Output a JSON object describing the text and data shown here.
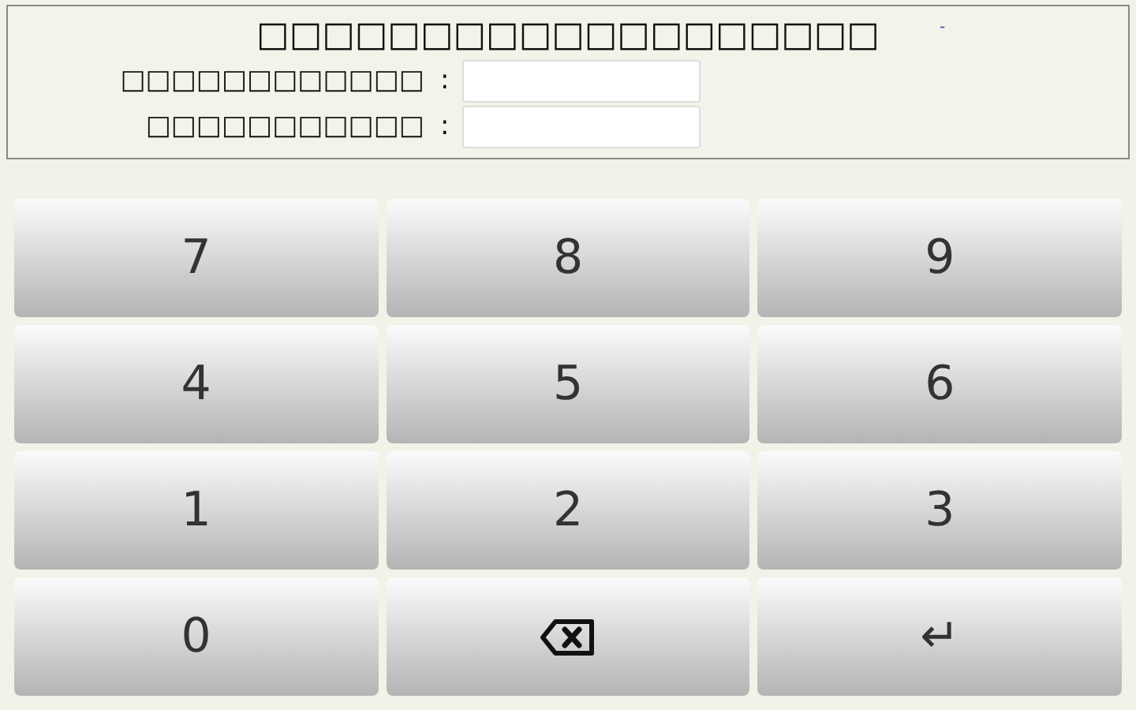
{
  "header": {
    "title": "□□□□□□□□□□□□□□□□□□□",
    "link": "-",
    "fields": [
      {
        "label": "□□□□□□□□□□□□",
        "separator": ":"
      },
      {
        "label": "□□□□□□□□□□□",
        "separator": ":"
      }
    ]
  },
  "keypad": [
    {
      "kind": "digit",
      "label": "7"
    },
    {
      "kind": "digit",
      "label": "8"
    },
    {
      "kind": "digit",
      "label": "9"
    },
    {
      "kind": "digit",
      "label": "4"
    },
    {
      "kind": "digit",
      "label": "5"
    },
    {
      "kind": "digit",
      "label": "6"
    },
    {
      "kind": "digit",
      "label": "1"
    },
    {
      "kind": "digit",
      "label": "2"
    },
    {
      "kind": "digit",
      "label": "3"
    },
    {
      "kind": "digit",
      "label": "0"
    },
    {
      "kind": "backspace"
    },
    {
      "kind": "enter",
      "label": "↵"
    }
  ]
}
